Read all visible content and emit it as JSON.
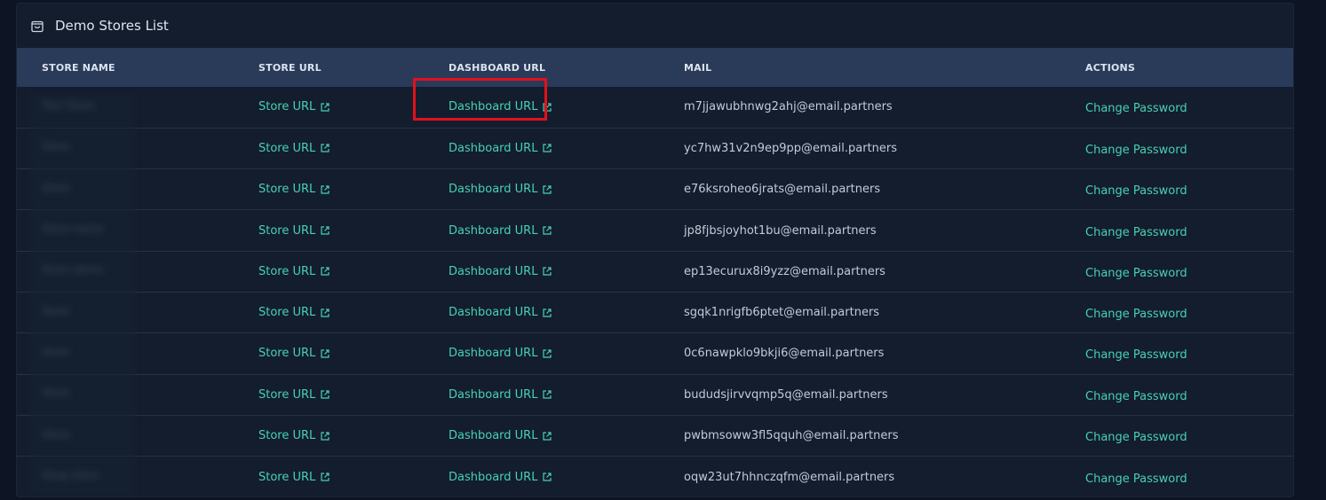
{
  "panel": {
    "title": "Demo Stores List",
    "icon": "shopping-bag-icon"
  },
  "table": {
    "headers": {
      "store_name": "STORE NAME",
      "store_url": "STORE URL",
      "dashboard_url": "DASHBOARD URL",
      "mail": "MAIL",
      "actions": "ACTIONS"
    },
    "rows": [
      {
        "store_name": "Test Store",
        "store_url": "Store URL",
        "dashboard_url": "Dashboard URL",
        "mail": "m7jjawubhnwg2ahj@email.partners",
        "action": "Change Password"
      },
      {
        "store_name": "Store",
        "store_url": "Store URL",
        "dashboard_url": "Dashboard URL",
        "mail": "yc7hw31v2n9ep9pp@email.partners",
        "action": "Change Password"
      },
      {
        "store_name": "Store",
        "store_url": "Store URL",
        "dashboard_url": "Dashboard URL",
        "mail": "e76ksroheo6jrats@email.partners",
        "action": "Change Password"
      },
      {
        "store_name": "Store name",
        "store_url": "Store URL",
        "dashboard_url": "Dashboard URL",
        "mail": "jp8fjbsjoyhot1bu@email.partners",
        "action": "Change Password"
      },
      {
        "store_name": "Store demo",
        "store_url": "Store URL",
        "dashboard_url": "Dashboard URL",
        "mail": "ep13ecurux8i9yzz@email.partners",
        "action": "Change Password"
      },
      {
        "store_name": "Store",
        "store_url": "Store URL",
        "dashboard_url": "Dashboard URL",
        "mail": "sgqk1nrigfb6ptet@email.partners",
        "action": "Change Password"
      },
      {
        "store_name": "Store",
        "store_url": "Store URL",
        "dashboard_url": "Dashboard URL",
        "mail": "0c6nawpklo9bkji6@email.partners",
        "action": "Change Password"
      },
      {
        "store_name": "Store",
        "store_url": "Store URL",
        "dashboard_url": "Dashboard URL",
        "mail": "bududsjirvvqmp5q@email.partners",
        "action": "Change Password"
      },
      {
        "store_name": "Store",
        "store_url": "Store URL",
        "dashboard_url": "Dashboard URL",
        "mail": "pwbmsoww3fl5qquh@email.partners",
        "action": "Change Password"
      },
      {
        "store_name": "Shop store",
        "store_url": "Store URL",
        "dashboard_url": "Dashboard URL",
        "mail": "oqw23ut7hhnczqfm@email.partners",
        "action": "Change Password"
      }
    ]
  },
  "colors": {
    "accent": "#48d1b0",
    "highlight": "#e2111b",
    "header_bg": "#2a3a59",
    "panel_bg": "#131d2e"
  }
}
